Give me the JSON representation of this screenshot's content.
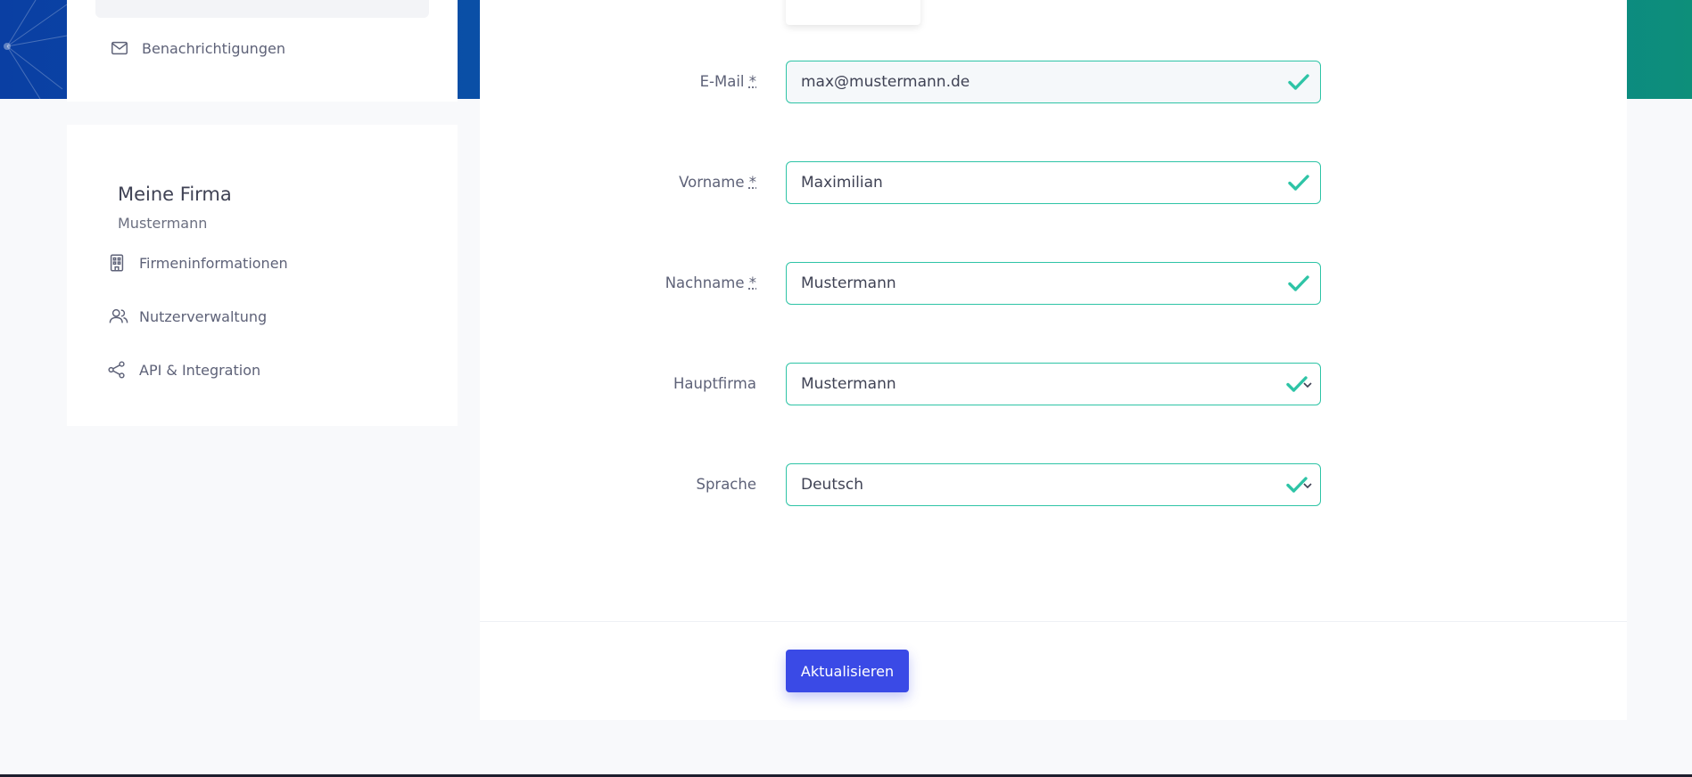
{
  "colors": {
    "accent": "#3a4ae6",
    "valid": "#2ec4a6",
    "band_left": "#0a3fa3",
    "band_right": "#0d8f7a",
    "text": "#3f4254",
    "muted": "#5e6278"
  },
  "sidebar": {
    "top_items": [
      {
        "label": "Benachrichtigungen",
        "icon": "mail-icon"
      }
    ],
    "company": {
      "title": "Meine Firma",
      "subtitle": "Mustermann",
      "items": [
        {
          "label": "Firmeninformationen",
          "icon": "building-icon"
        },
        {
          "label": "Nutzerverwaltung",
          "icon": "users-icon"
        },
        {
          "label": "API & Integration",
          "icon": "share-icon"
        }
      ]
    }
  },
  "form": {
    "fields": [
      {
        "label": "E-Mail",
        "required_mark": "*",
        "value": "max@mustermann.de",
        "type": "text"
      },
      {
        "label": "Vorname",
        "required_mark": "*",
        "value": "Maximilian",
        "type": "text"
      },
      {
        "label": "Nachname",
        "required_mark": "*",
        "value": "Mustermann",
        "type": "text"
      },
      {
        "label": "Hauptfirma",
        "required_mark": "",
        "value": "Mustermann",
        "type": "select"
      },
      {
        "label": "Sprache",
        "required_mark": "",
        "value": "Deutsch",
        "type": "select"
      }
    ],
    "submit_label": "Aktualisieren"
  }
}
